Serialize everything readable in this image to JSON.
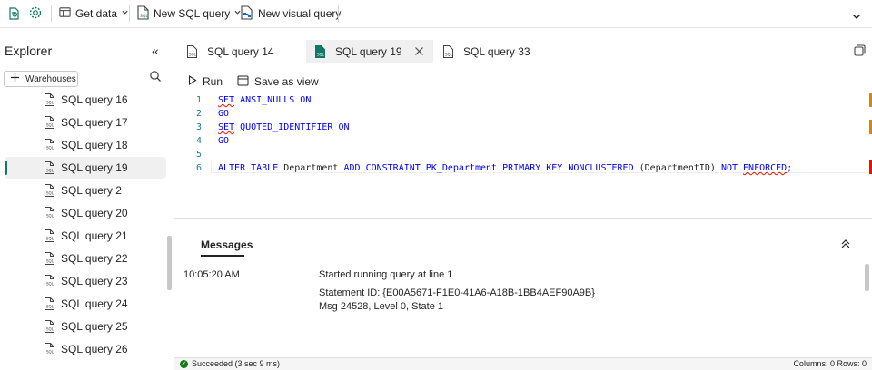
{
  "toolbar": {
    "get_data_label": "Get data",
    "new_sql_query_label": "New SQL query",
    "new_visual_query_label": "New visual query"
  },
  "explorer": {
    "title": "Explorer",
    "collapse_glyph": "«",
    "warehouses_label": "Warehouses",
    "items": [
      {
        "label": "SQL query 16"
      },
      {
        "label": "SQL query 17"
      },
      {
        "label": "SQL query 18"
      },
      {
        "label": "SQL query 19",
        "active": true
      },
      {
        "label": "SQL query 2"
      },
      {
        "label": "SQL query 20"
      },
      {
        "label": "SQL query 21"
      },
      {
        "label": "SQL query 22"
      },
      {
        "label": "SQL query 23"
      },
      {
        "label": "SQL query 24"
      },
      {
        "label": "SQL query 25"
      },
      {
        "label": "SQL query 26"
      }
    ]
  },
  "tabs": [
    {
      "label": "SQL query 14"
    },
    {
      "label": "SQL query 19",
      "active": true
    },
    {
      "label": "SQL query 33"
    }
  ],
  "editor": {
    "run_label": "Run",
    "save_as_view_label": "Save as view",
    "lines": [
      {
        "num": "1",
        "kw1": "SET",
        "rest": " ANSI_NULLS ON"
      },
      {
        "num": "2",
        "kw1": "GO",
        "rest": ""
      },
      {
        "num": "3",
        "kw1": "SET",
        "rest": " QUOTED_IDENTIFIER ON"
      },
      {
        "num": "4",
        "kw1": "GO",
        "rest": ""
      },
      {
        "num": "5",
        "kw1": "",
        "rest": ""
      },
      {
        "num": "6",
        "kw1": "ALTER TABLE",
        "rest": ""
      }
    ],
    "line6": {
      "a": "ALTER TABLE ",
      "b": "Department",
      "c": " ADD CONSTRAINT ",
      "d": "PK_Department",
      "e": " PRIMARY KEY NONCLUSTERED ",
      "f": "(DepartmentID)",
      "g": " NOT ",
      "h": "ENFORCED",
      "i": ";"
    }
  },
  "messages": {
    "title": "Messages",
    "time": "10:05:20 AM",
    "line1": "Started running query at line 1",
    "line2": "Statement ID: {E00A5671-F1E0-41A6-A18B-1BB4AEF90A9B}",
    "line3": "Msg 24528, Level 0, State 1"
  },
  "status": {
    "text": "Succeeded (3 sec 9 ms)",
    "columns_label": "Columns: 0",
    "rows_label": "Rows: 0"
  },
  "colors": {
    "accent": "#117865",
    "keyword": "#0000ff",
    "line_number": "#237893",
    "error": "#e51400",
    "warning": "#d18616",
    "success": "#107c10"
  }
}
